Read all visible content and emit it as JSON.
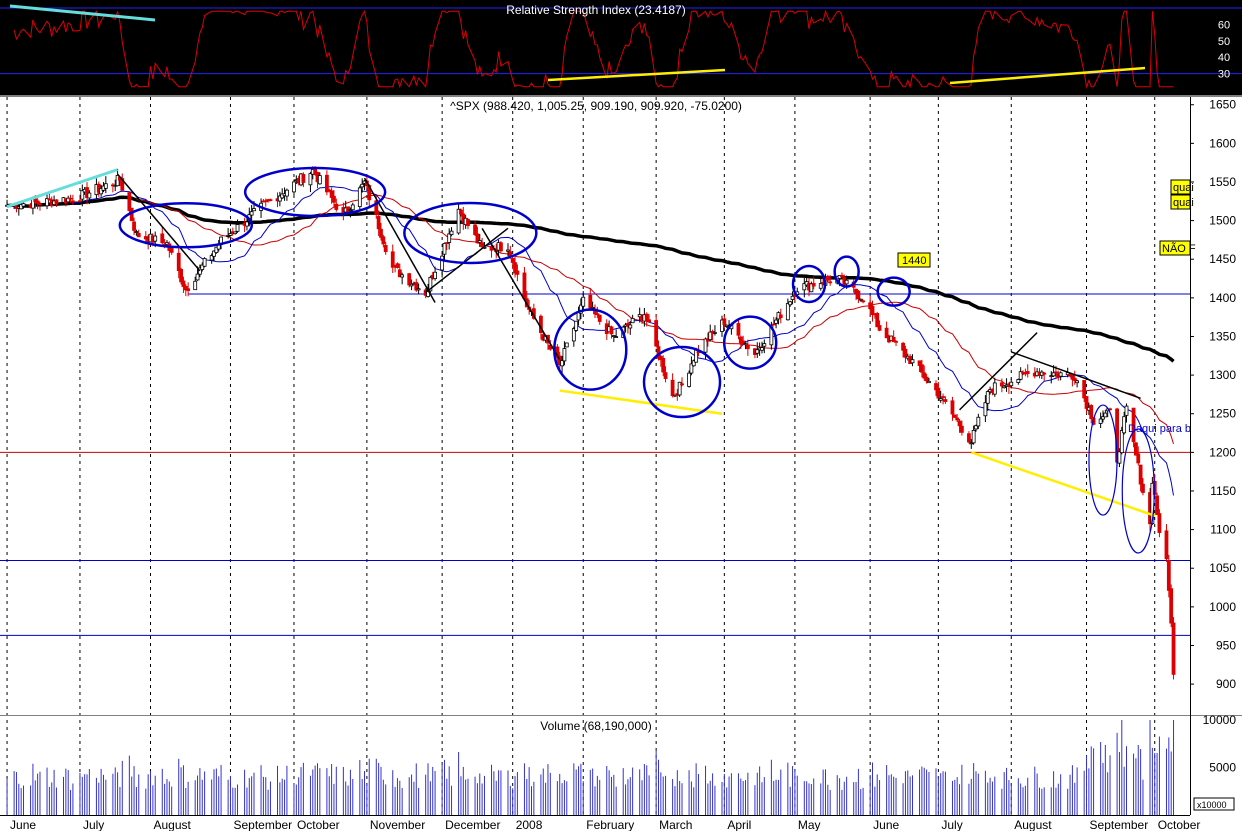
{
  "chart_data": {
    "type": "candlestick",
    "rsi_panel": {
      "title": "Relative Strength Index (23.4187)",
      "y_ticks": [
        30,
        40,
        50,
        60
      ],
      "ylim": [
        20,
        70
      ],
      "reference_lines": [
        30,
        70
      ]
    },
    "price_panel": {
      "title": "^SPX (988.420, 1,005.25, 909.190, 909.920, -75.0200)",
      "y_ticks": [
        900,
        950,
        1000,
        1050,
        1100,
        1150,
        1200,
        1250,
        1300,
        1350,
        1400,
        1450,
        1500,
        1550,
        1600,
        1650
      ],
      "ylim": [
        860,
        1660
      ],
      "horizontal_lines": [
        {
          "value": 1405,
          "color": "#0000cc"
        },
        {
          "value": 1200,
          "color": "#cc0000"
        },
        {
          "value": 1060,
          "color": "#0000cc"
        },
        {
          "value": 963,
          "color": "#0000cc"
        }
      ],
      "annotations": [
        "quai",
        "quai",
        "NÃO F",
        "1440",
        "Daqui para b"
      ],
      "close_path": [
        [
          "2007-06-01",
          1520
        ],
        [
          "2007-06-20",
          1525
        ],
        [
          "2007-07-01",
          1530
        ],
        [
          "2007-07-19",
          1553
        ],
        [
          "2007-07-26",
          1482
        ],
        [
          "2007-08-08",
          1470
        ],
        [
          "2007-08-16",
          1411
        ],
        [
          "2007-08-31",
          1474
        ],
        [
          "2007-09-18",
          1519
        ],
        [
          "2007-10-09",
          1565
        ],
        [
          "2007-10-22",
          1506
        ],
        [
          "2007-10-31",
          1549
        ],
        [
          "2007-11-12",
          1439
        ],
        [
          "2007-11-26",
          1407
        ],
        [
          "2007-12-10",
          1515
        ],
        [
          "2007-12-20",
          1463
        ],
        [
          "2007-12-31",
          1468
        ],
        [
          "2008-01-08",
          1390
        ],
        [
          "2008-01-22",
          1311
        ],
        [
          "2008-02-01",
          1395
        ],
        [
          "2008-02-14",
          1349
        ],
        [
          "2008-02-27",
          1380
        ],
        [
          "2008-03-10",
          1273
        ],
        [
          "2008-03-14",
          1288
        ],
        [
          "2008-03-20",
          1330
        ],
        [
          "2008-04-01",
          1370
        ],
        [
          "2008-04-14",
          1328
        ],
        [
          "2008-05-02",
          1413
        ],
        [
          "2008-05-19",
          1426
        ],
        [
          "2008-05-30",
          1400
        ],
        [
          "2008-06-06",
          1360
        ],
        [
          "2008-06-20",
          1317
        ],
        [
          "2008-06-30",
          1280
        ],
        [
          "2008-07-15",
          1214
        ],
        [
          "2008-07-23",
          1282
        ],
        [
          "2008-08-11",
          1305
        ],
        [
          "2008-08-28",
          1300
        ],
        [
          "2008-09-05",
          1242
        ],
        [
          "2008-09-12",
          1251
        ],
        [
          "2008-09-15",
          1192
        ],
        [
          "2008-09-19",
          1255
        ],
        [
          "2008-09-29",
          1106
        ],
        [
          "2008-09-30",
          1166
        ],
        [
          "2008-10-03",
          1099
        ],
        [
          "2008-10-06",
          1056
        ],
        [
          "2008-10-08",
          984
        ],
        [
          "2008-10-09",
          910
        ]
      ]
    },
    "volume_panel": {
      "title": "Volume (68,190,000)",
      "y_ticks": [
        5000,
        10000
      ],
      "ylim": [
        0,
        10000
      ],
      "unit_label": "x10000"
    },
    "x_axis": {
      "labels": [
        "June",
        "July",
        "August",
        "September",
        "October",
        "November",
        "December",
        "2008",
        "February",
        "March",
        "April",
        "May",
        "June",
        "July",
        "August",
        "September",
        "October"
      ]
    }
  }
}
